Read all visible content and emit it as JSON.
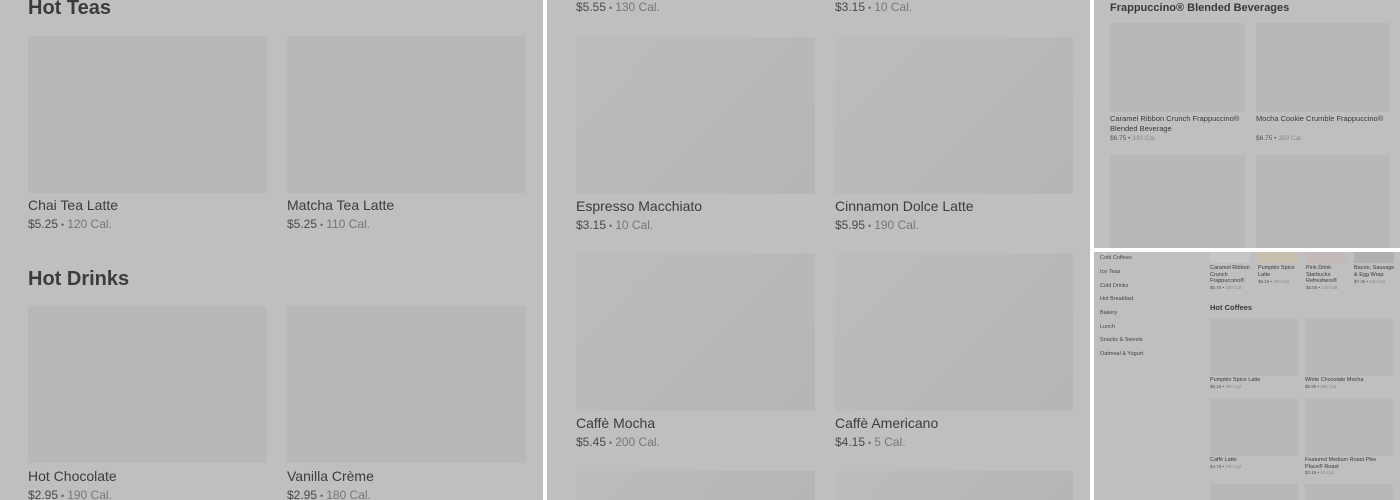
{
  "panel1": {
    "hot_teas_title": "Hot Teas",
    "hot_teas": [
      {
        "name": "Chai Tea Latte",
        "price": "$5.25",
        "cal": "120 Cal."
      },
      {
        "name": "Matcha Tea Latte",
        "price": "$5.25",
        "cal": "110 Cal."
      }
    ],
    "hot_drinks_title": "Hot Drinks",
    "hot_drinks": [
      {
        "name": "Hot Chocolate",
        "price": "$2.95",
        "cal": "190 Cal."
      },
      {
        "name": "Vanilla Crème",
        "price": "$2.95",
        "cal": "180 Cal."
      }
    ]
  },
  "panel2": {
    "top_meta": [
      {
        "price": "$5.55",
        "cal": "130 Cal."
      },
      {
        "price": "$3.15",
        "cal": "10 Cal."
      }
    ],
    "items": [
      {
        "name": "Espresso Macchiato",
        "price": "$3.15",
        "cal": "10 Cal."
      },
      {
        "name": "Cinnamon Dolce Latte",
        "price": "$5.95",
        "cal": "190 Cal."
      },
      {
        "name": "Caffè Mocha",
        "price": "$5.45",
        "cal": "200 Cal."
      },
      {
        "name": "Caffè Americano",
        "price": "$4.15",
        "cal": "5 Cal."
      }
    ]
  },
  "panel3": {
    "title": "Frappuccino® Blended Beverages",
    "items": [
      {
        "name": "Caramel Ribbon Crunch Frappuccino® Blended Beverage",
        "price": "$6.75",
        "cal": "330 Cal."
      },
      {
        "name": "Mocha Cookie Crumble Frappuccino®",
        "price": "$6.75",
        "cal": "350 Cal."
      }
    ]
  },
  "panel4": {
    "sidebar": [
      "Cold Coffees",
      "Ice Teas",
      "Cold Drinks",
      "Hot Breakfast",
      "Bakery",
      "Lunch",
      "Snacks & Sweets",
      "Oatmeal & Yogurt"
    ],
    "featured": [
      {
        "name": "Caramel Ribbon Crunch Frappuccino®",
        "price": "$6.75",
        "cal": "330 Cal."
      },
      {
        "name": "Pumpkin Spice Latte",
        "price": "$6.15",
        "cal": "390 Cal."
      },
      {
        "name": "Pink Drink Starbucks Refreshers®",
        "price": "$5.55",
        "cal": "140 Cal."
      },
      {
        "name": "Bacon, Sausage & Egg Wrap",
        "price": "$7.45",
        "cal": "640 Cal."
      }
    ],
    "hot_coffees_title": "Hot Coffees",
    "hot_coffees": [
      {
        "name": "Pumpkin Spice Latte",
        "price": "$6.15",
        "cal": "390 Cal."
      },
      {
        "name": "White Chocolate Mocha",
        "price": "$5.95",
        "cal": "390 Cal."
      },
      {
        "name": "Caffè Latte",
        "price": "$4.75",
        "cal": "190 Cal."
      },
      {
        "name": "Featured Medium Roast Pike Place® Roast",
        "price": "$3.15",
        "cal": "10 Cal."
      }
    ]
  }
}
